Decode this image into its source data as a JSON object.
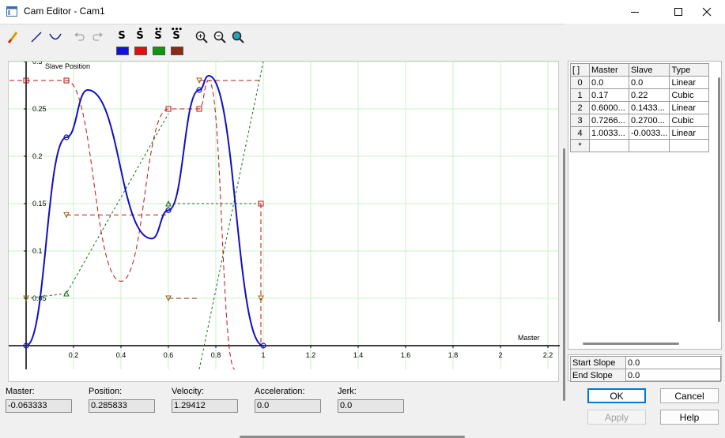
{
  "window": {
    "title": "Cam Editor - Cam1"
  },
  "toolbar": {
    "derivs": [
      "S",
      "S",
      "S",
      "S"
    ],
    "swatches": [
      "#1010e0",
      "#e01010",
      "#129512",
      "#8a2a18"
    ],
    "icons": [
      "marker-icon",
      "line-icon",
      "curve-icon",
      "undo-icon",
      "redo-icon",
      "zoom-in-icon",
      "zoom-out-icon",
      "zoom-fit-icon"
    ]
  },
  "plot": {
    "ylabel": "Slave Position",
    "xlabel": "Master",
    "xticks": [
      "0.2",
      "0.4",
      "0.6",
      "0.8",
      "1",
      "1.2",
      "1.4",
      "1.6",
      "1.8",
      "2",
      "2.2"
    ],
    "yticks": [
      "0.05",
      "0.1",
      "0.15",
      "0.2",
      "0.25",
      "0.3"
    ]
  },
  "chart_data": {
    "type": "line",
    "title": "",
    "xlabel": "Master",
    "ylabel": "Slave Position",
    "xlim": [
      -0.07,
      2.2
    ],
    "ylim": [
      -0.025,
      0.3
    ],
    "grid": true,
    "series": [
      {
        "color": "#1010c0",
        "style": "solid",
        "points": [
          [
            0,
            0
          ],
          [
            0.17,
            0.22
          ],
          [
            0.26,
            0.27
          ],
          [
            0.53,
            0.113
          ],
          [
            0.6,
            0.143
          ],
          [
            0.73,
            0.27
          ],
          [
            0.77,
            0.285
          ],
          [
            1.0,
            0
          ]
        ]
      },
      {
        "color": "#c01010",
        "style": "dashed",
        "points": [
          [
            -0.07,
            0.28
          ],
          [
            0.17,
            0.28
          ],
          [
            0.4,
            0.068
          ],
          [
            0.6,
            0.25
          ],
          [
            0.73,
            0.25
          ],
          [
            0.77,
            0.28
          ],
          [
            0.88,
            -0.025
          ]
        ]
      },
      {
        "color": "#107010",
        "style": "dotted",
        "points": [
          [
            0,
            0.05
          ],
          [
            0.17,
            0.055
          ],
          [
            0.6,
            0.245
          ]
        ]
      }
    ]
  },
  "table": {
    "headers": [
      "[ ]",
      "Master",
      "Slave",
      "Type"
    ],
    "rows": [
      [
        "0",
        "0.0",
        "0.0",
        "Linear"
      ],
      [
        "1",
        "0.17",
        "0.22",
        "Cubic"
      ],
      [
        "2",
        "0.6000...",
        "0.1433...",
        "Linear"
      ],
      [
        "3",
        "0.7266...",
        "0.2700...",
        "Cubic"
      ],
      [
        "4",
        "1.0033...",
        "-0.0033...",
        "Linear"
      ],
      [
        "*",
        "",
        "",
        ""
      ]
    ]
  },
  "slopes": {
    "start_label": "Start Slope",
    "start_value": "0.0",
    "end_label": "End Slope",
    "end_value": "0.0"
  },
  "status": {
    "master_label": "Master:",
    "master_value": "-0.063333",
    "position_label": "Position:",
    "position_value": "0.285833",
    "velocity_label": "Velocity:",
    "velocity_value": "1.29412",
    "acceleration_label": "Acceleration:",
    "acceleration_value": "0.0",
    "jerk_label": "Jerk:",
    "jerk_value": "0.0"
  },
  "buttons": {
    "ok": "OK",
    "cancel": "Cancel",
    "apply": "Apply",
    "help": "Help"
  }
}
